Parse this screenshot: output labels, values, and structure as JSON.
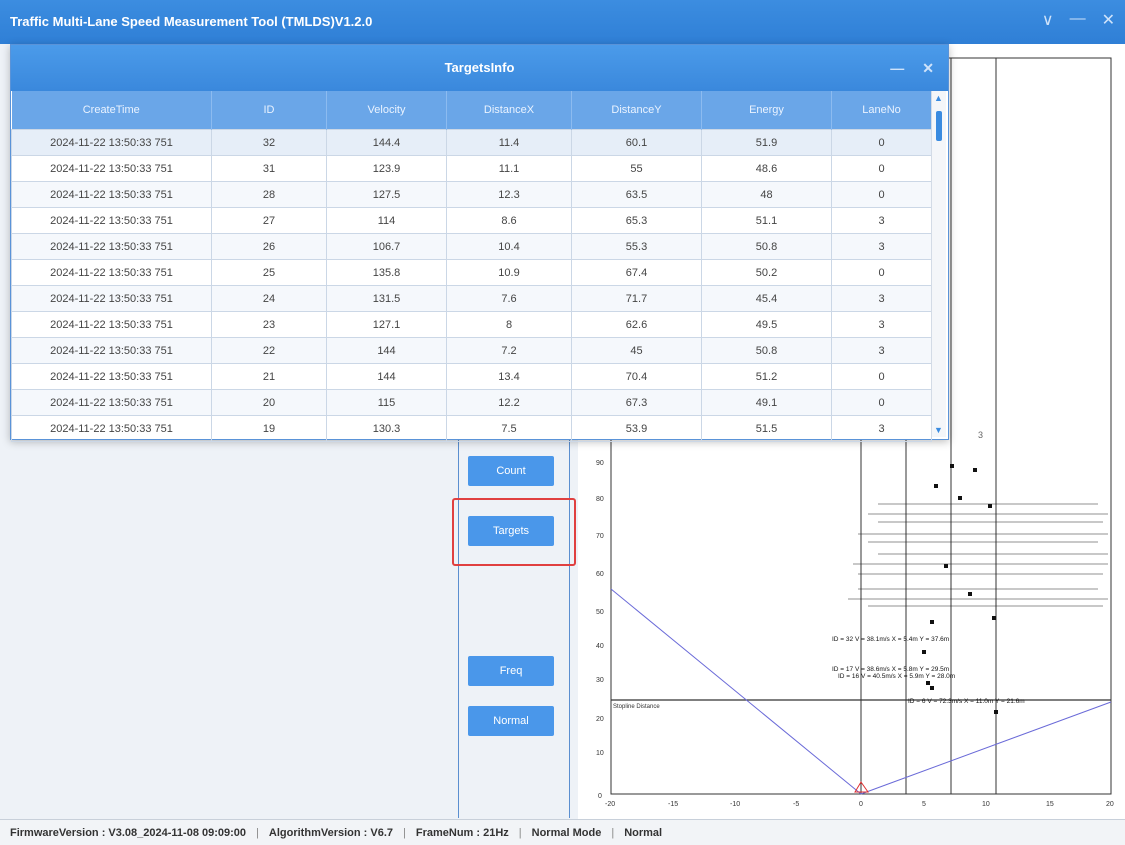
{
  "app": {
    "title": "Traffic Multi-Lane Speed Measurement Tool (TMLDS)V1.2.0"
  },
  "window_controls": [
    "∨",
    "—",
    "✕"
  ],
  "dialog": {
    "title": "TargetsInfo",
    "controls": [
      "—",
      "✕"
    ],
    "columns": [
      "CreateTime",
      "ID",
      "Velocity",
      "DistanceX",
      "DistanceY",
      "Energy",
      "LaneNo"
    ],
    "rows": [
      [
        "2024-11-22 13:50:33 751",
        "32",
        "144.4",
        "11.4",
        "60.1",
        "51.9",
        "0"
      ],
      [
        "2024-11-22 13:50:33 751",
        "31",
        "123.9",
        "11.1",
        "55",
        "48.6",
        "0"
      ],
      [
        "2024-11-22 13:50:33 751",
        "28",
        "127.5",
        "12.3",
        "63.5",
        "48",
        "0"
      ],
      [
        "2024-11-22 13:50:33 751",
        "27",
        "114",
        "8.6",
        "65.3",
        "51.1",
        "3"
      ],
      [
        "2024-11-22 13:50:33 751",
        "26",
        "106.7",
        "10.4",
        "55.3",
        "50.8",
        "3"
      ],
      [
        "2024-11-22 13:50:33 751",
        "25",
        "135.8",
        "10.9",
        "67.4",
        "50.2",
        "0"
      ],
      [
        "2024-11-22 13:50:33 751",
        "24",
        "131.5",
        "7.6",
        "71.7",
        "45.4",
        "3"
      ],
      [
        "2024-11-22 13:50:33 751",
        "23",
        "127.1",
        "8",
        "62.6",
        "49.5",
        "3"
      ],
      [
        "2024-11-22 13:50:33 751",
        "22",
        "144",
        "7.2",
        "45",
        "50.8",
        "3"
      ],
      [
        "2024-11-22 13:50:33 751",
        "21",
        "144",
        "13.4",
        "70.4",
        "51.2",
        "0"
      ],
      [
        "2024-11-22 13:50:33 751",
        "20",
        "115",
        "12.2",
        "67.3",
        "49.1",
        "0"
      ],
      [
        "2024-11-22 13:50:33 751",
        "19",
        "130.3",
        "7.5",
        "53.9",
        "51.5",
        "3"
      ]
    ]
  },
  "buttons": {
    "count": "Count",
    "targets": "Targets",
    "freq": "Freq",
    "normal": "Normal"
  },
  "plot": {
    "x_ticks": [
      "-20",
      "-15",
      "-10",
      "-5",
      "0",
      "5",
      "10",
      "15",
      "20"
    ],
    "y_ticks": [
      "0",
      "10",
      "20",
      "30",
      "40",
      "50",
      "60",
      "70",
      "80",
      "90"
    ],
    "lane_label": "3",
    "stopline_label": "Stopline Distance",
    "target_labels": [
      "ID = 32 V = 38.1m/s X = 5.4m Y = 37.6m",
      "ID = 17 V = 38.6m/s X = 5.8m Y = 29.5m",
      "ID = 16 V = 40.5m/s X = 5.9m Y = 28.0m",
      "ID = 6 V = 72.3m/s X = 11.0m Y = 21.6m"
    ],
    "colors": {
      "lane_lines": "#333333",
      "fov": "#6a6ad8",
      "radar": "#e03030"
    }
  },
  "status": {
    "firmware": "FirmwareVersion : V3.08_2024-11-08 09:09:00",
    "algorithm": "AlgorithmVersion : V6.7",
    "frame": "FrameNum : 21Hz",
    "mode": "Normal Mode",
    "state": "Normal",
    "separator": "|"
  }
}
